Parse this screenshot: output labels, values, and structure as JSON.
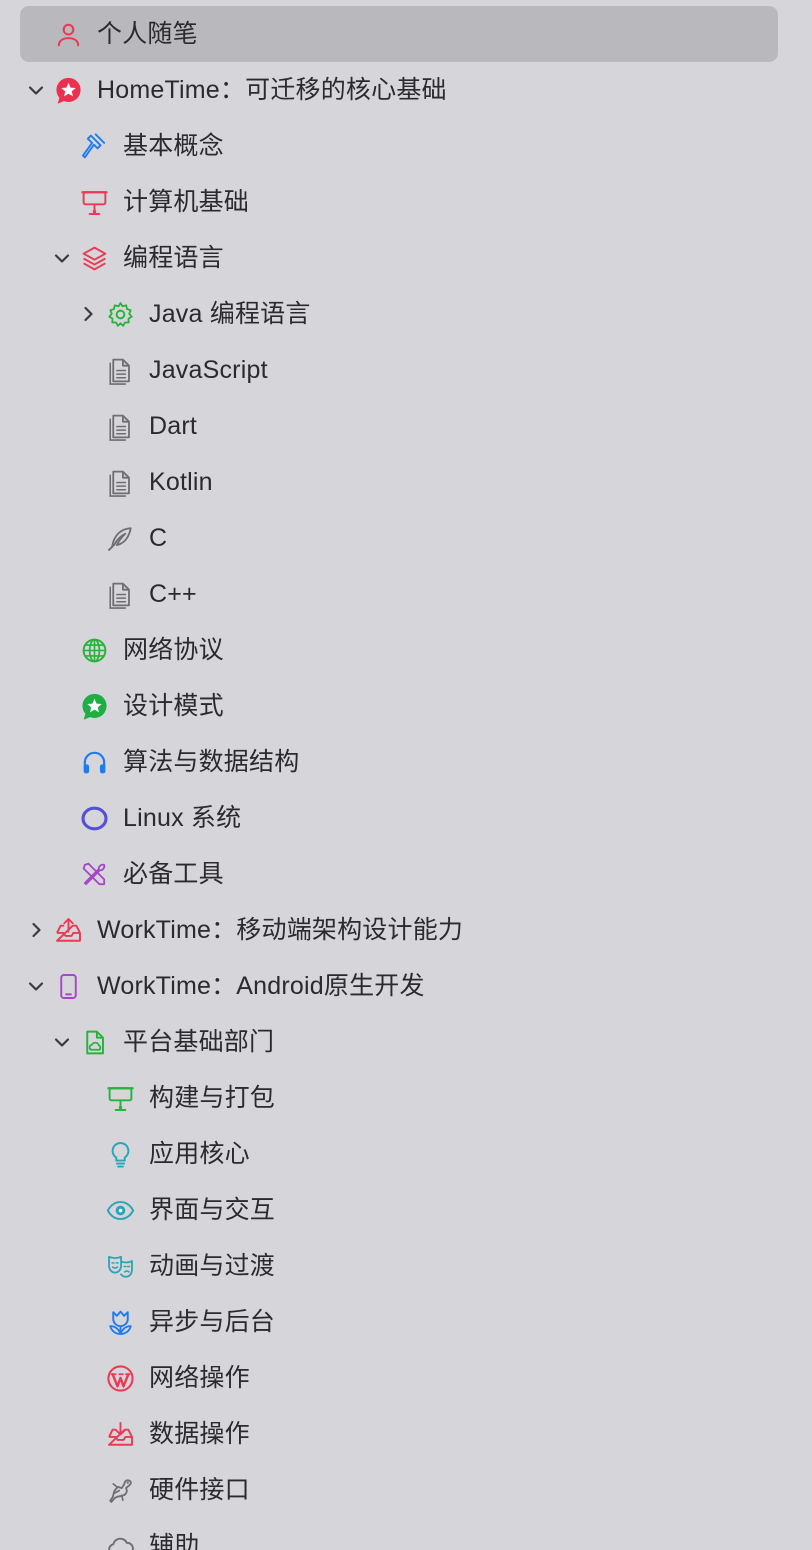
{
  "sidebar": {
    "rows": [
      {
        "label": "个人随笔",
        "icon": "person-icon",
        "level": 0,
        "selected": true
      },
      {
        "label": "HomeTime：可迁移的核心基础",
        "icon": "star-bubble-icon",
        "level": 0,
        "expanded": true,
        "color": "#ef2f4f"
      },
      {
        "label": "基本概念",
        "icon": "hammer-icon",
        "level": 1,
        "color": "#1e7bf0"
      },
      {
        "label": "计算机基础",
        "icon": "presentation-icon",
        "level": 1,
        "color": "#ea3a55"
      },
      {
        "label": "编程语言",
        "icon": "layers-icon",
        "level": 1,
        "expanded": true,
        "color": "#ea3a55"
      },
      {
        "label": "Java 编程语言",
        "icon": "gear-icon",
        "level": 2,
        "expanded": false,
        "color": "#27b33b"
      },
      {
        "label": "JavaScript",
        "icon": "document-icon",
        "level": 2,
        "color": "#6e6e73"
      },
      {
        "label": "Dart",
        "icon": "document-icon",
        "level": 2,
        "color": "#6e6e73"
      },
      {
        "label": "Kotlin",
        "icon": "document-icon",
        "level": 2,
        "color": "#6e6e73"
      },
      {
        "label": "C",
        "icon": "feather-icon",
        "level": 2,
        "color": "#6e6e73"
      },
      {
        "label": "C++",
        "icon": "document-icon",
        "level": 2,
        "color": "#6e6e73"
      },
      {
        "label": "网络协议",
        "icon": "globe-icon",
        "level": 1,
        "color": "#27b33b"
      },
      {
        "label": "设计模式",
        "icon": "star-bubble-icon",
        "level": 1,
        "color": "#1fae43"
      },
      {
        "label": "算法与数据结构",
        "icon": "headphones-icon",
        "level": 1,
        "color": "#1e7bf0"
      },
      {
        "label": "Linux 系统",
        "icon": "ring-icon",
        "level": 1,
        "color": "#5450d4"
      },
      {
        "label": "必备工具",
        "icon": "tools-icon",
        "level": 1,
        "color": "#a547c8"
      },
      {
        "label": "WorkTime：移动端架构设计能力",
        "icon": "inbox-upload-icon",
        "level": 0,
        "expanded": false,
        "color": "#ea3a55"
      },
      {
        "label": "WorkTime：Android原生开发",
        "icon": "phone-icon",
        "level": 0,
        "expanded": true,
        "color": "#a547c8"
      },
      {
        "label": "平台基础部门",
        "icon": "document-cloud-icon",
        "level": 1,
        "expanded": true,
        "color": "#27b33b"
      },
      {
        "label": "构建与打包",
        "icon": "presentation-icon",
        "level": 2,
        "color": "#27b33b"
      },
      {
        "label": "应用核心",
        "icon": "lightbulb-icon",
        "level": 2,
        "color": "#2aa5b8"
      },
      {
        "label": "界面与交互",
        "icon": "eye-icon",
        "level": 2,
        "color": "#2aa5b8"
      },
      {
        "label": "动画与过渡",
        "icon": "theater-masks-icon",
        "level": 2,
        "color": "#2aa5b8"
      },
      {
        "label": "异步与后台",
        "icon": "tulip-icon",
        "level": 2,
        "color": "#1e7bf0"
      },
      {
        "label": "网络操作",
        "icon": "wordpress-icon",
        "level": 2,
        "color": "#ea3a55"
      },
      {
        "label": "数据操作",
        "icon": "inbox-download-icon",
        "level": 2,
        "color": "#ea3a55"
      },
      {
        "label": "硬件接口",
        "icon": "lizard-icon",
        "level": 2,
        "color": "#6e6e73"
      },
      {
        "label": "辅助",
        "icon": "cloud-icon",
        "level": 2,
        "color": "#6e6e73"
      }
    ]
  },
  "colors": {
    "background": "#d6d6da",
    "selection": "#b9b9bd",
    "text": "#2b2b2e",
    "chevron": "#3c3c40"
  }
}
